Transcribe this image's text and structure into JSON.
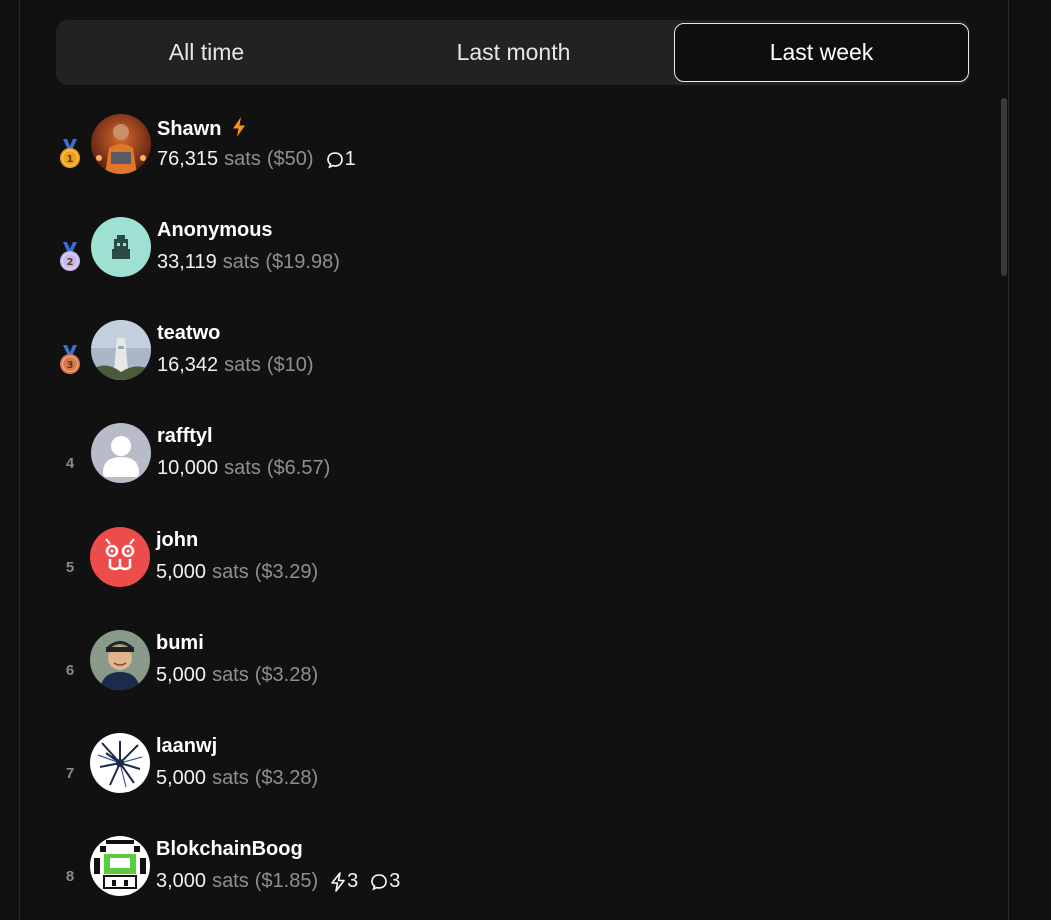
{
  "tabs": [
    {
      "label": "All time",
      "active": false
    },
    {
      "label": "Last month",
      "active": false
    },
    {
      "label": "Last week",
      "active": true
    }
  ],
  "leaderboard": [
    {
      "rank": "1",
      "medal": "gold",
      "name": "Shawn",
      "zap_badge": true,
      "sats": "76,315",
      "unit": "sats",
      "usd": "($50)",
      "comments": "1",
      "zaps": null,
      "avatar": "avatar-shawn"
    },
    {
      "rank": "2",
      "medal": "silver",
      "name": "Anonymous",
      "zap_badge": false,
      "sats": "33,119",
      "unit": "sats",
      "usd": "($19.98)",
      "comments": null,
      "zaps": null,
      "avatar": "avatar-anonymous"
    },
    {
      "rank": "3",
      "medal": "bronze",
      "name": "teatwo",
      "zap_badge": false,
      "sats": "16,342",
      "unit": "sats",
      "usd": "($10)",
      "comments": null,
      "zaps": null,
      "avatar": "avatar-teatwo"
    },
    {
      "rank": "4",
      "medal": null,
      "name": "rafftyl",
      "zap_badge": false,
      "sats": "10,000",
      "unit": "sats",
      "usd": "($6.57)",
      "comments": null,
      "zaps": null,
      "avatar": "avatar-default"
    },
    {
      "rank": "5",
      "medal": null,
      "name": "john",
      "zap_badge": false,
      "sats": "5,000",
      "unit": "sats",
      "usd": "($3.29)",
      "comments": null,
      "zaps": null,
      "avatar": "avatar-john"
    },
    {
      "rank": "6",
      "medal": null,
      "name": "bumi",
      "zap_badge": false,
      "sats": "5,000",
      "unit": "sats",
      "usd": "($3.28)",
      "comments": null,
      "zaps": null,
      "avatar": "avatar-bumi"
    },
    {
      "rank": "7",
      "medal": null,
      "name": "laanwj",
      "zap_badge": false,
      "sats": "5,000",
      "unit": "sats",
      "usd": "($3.28)",
      "comments": null,
      "zaps": null,
      "avatar": "avatar-laanwj"
    },
    {
      "rank": "8",
      "medal": null,
      "name": "BlokchainBoog",
      "zap_badge": false,
      "sats": "3,000",
      "unit": "sats",
      "usd": "($1.85)",
      "comments": "3",
      "zaps": "3",
      "avatar": "avatar-blokchainboog"
    }
  ],
  "colors": {
    "background": "#111111",
    "tab_bar": "#222222",
    "active_tab": "#0e0e0e",
    "muted_text": "#8f8f8f",
    "zap_accent": "#f7931a",
    "medal_gold": "#f0a11a",
    "medal_silver": "#c9b8f0",
    "medal_bronze": "#d9784a",
    "ribbon": "#3a6fd8"
  }
}
